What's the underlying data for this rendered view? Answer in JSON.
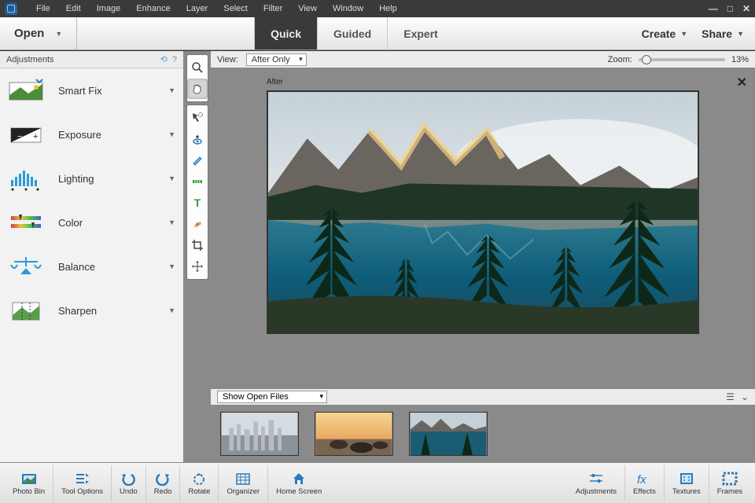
{
  "menu": [
    "File",
    "Edit",
    "Image",
    "Enhance",
    "Layer",
    "Select",
    "Filter",
    "View",
    "Window",
    "Help"
  ],
  "open_label": "Open",
  "modes": {
    "quick": "Quick",
    "guided": "Guided",
    "expert": "Expert",
    "active": "quick"
  },
  "create_label": "Create",
  "share_label": "Share",
  "panel_title": "Adjustments",
  "adjustments": [
    {
      "id": "smartfix",
      "label": "Smart Fix"
    },
    {
      "id": "exposure",
      "label": "Exposure"
    },
    {
      "id": "lighting",
      "label": "Lighting"
    },
    {
      "id": "color",
      "label": "Color"
    },
    {
      "id": "balance",
      "label": "Balance"
    },
    {
      "id": "sharpen",
      "label": "Sharpen"
    }
  ],
  "view_label": "View:",
  "view_option": "After Only",
  "zoom_label": "Zoom:",
  "zoom_value": "13%",
  "img_label": "After",
  "bin_option": "Show Open Files",
  "bottom_left": [
    {
      "id": "photobin",
      "label": "Photo Bin"
    },
    {
      "id": "tooloptions",
      "label": "Tool Options"
    },
    {
      "id": "undo",
      "label": "Undo"
    },
    {
      "id": "redo",
      "label": "Redo"
    },
    {
      "id": "rotate",
      "label": "Rotate"
    },
    {
      "id": "organizer",
      "label": "Organizer"
    },
    {
      "id": "homescreen",
      "label": "Home Screen"
    }
  ],
  "bottom_right": [
    {
      "id": "adjustments",
      "label": "Adjustments"
    },
    {
      "id": "effects",
      "label": "Effects"
    },
    {
      "id": "textures",
      "label": "Textures"
    },
    {
      "id": "frames",
      "label": "Frames"
    }
  ]
}
